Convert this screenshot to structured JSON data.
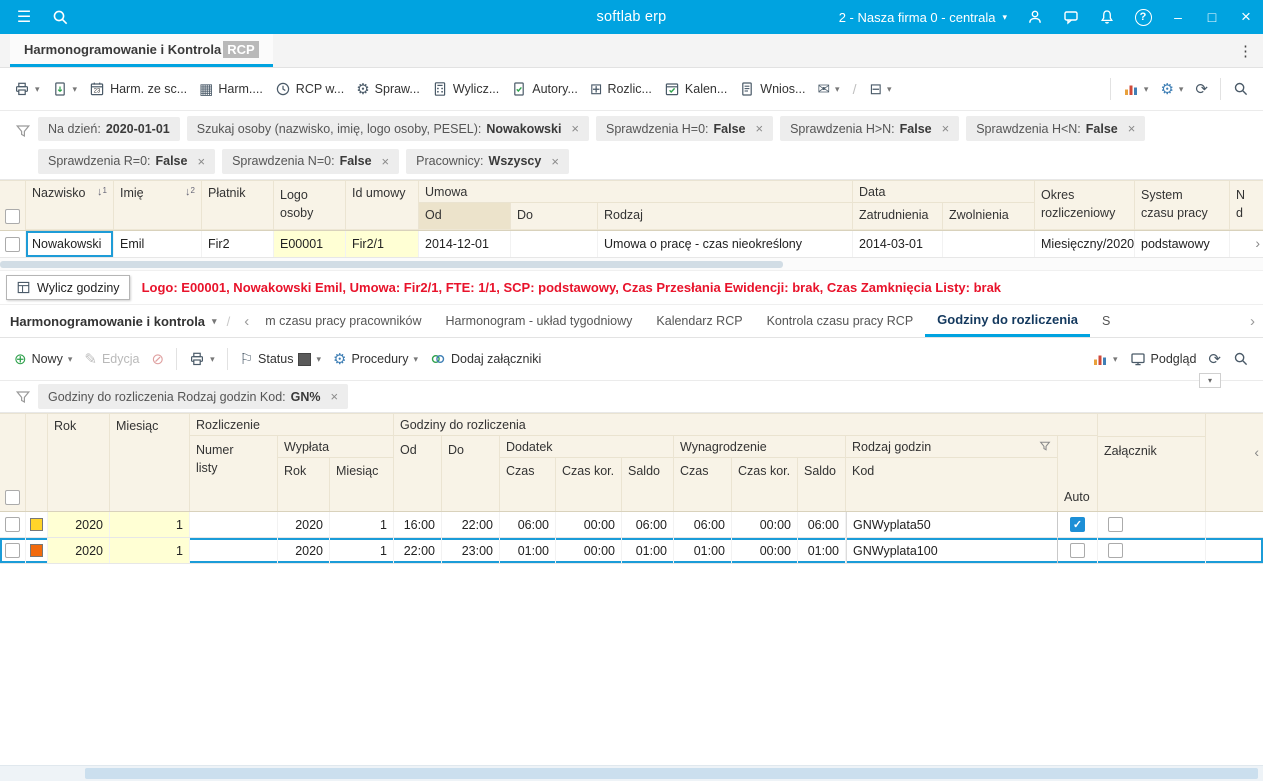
{
  "colors": {
    "topbar": "#00a3e0",
    "accent": "#00a3e0",
    "table_header_bg": "#f8f3e7",
    "selected_header_bg": "#ece3cb",
    "highlight_cell_bg": "#ffffd4",
    "status_text_red": "#e8132b",
    "active_tab_text": "#14395e",
    "checkbox_checked": "#1d8fd6"
  },
  "icons": {
    "hamburger": "☰",
    "caret_down": "▾",
    "chevron_left": "‹",
    "chevron_right": "›",
    "ellipsis_vertical": "⋮",
    "minimize": "–",
    "maximize": "□",
    "close": "×",
    "close_small": "×",
    "help": "?",
    "slash": "/",
    "refresh": "⟳",
    "envelope": "✉",
    "grid": "▦",
    "grid_plus": "⊞",
    "layout": "⊟",
    "gear": "⚙",
    "plus_circle": "⊕",
    "pencil": "✎",
    "no_entry": "⊘",
    "flag": "⚐",
    "check": "✓",
    "sort_desc": "↓"
  },
  "topbar": {
    "title": "softlab erp",
    "company": "2 - Nasza firma 0 - centrala"
  },
  "tabbar": {
    "tab_title": "Harmonogramowanie i Kontrola",
    "tab_title_highlight": "RCP"
  },
  "toolbar1": {
    "calendar_day": "23",
    "buttons": [
      "Harm. ze sc...",
      "Harm....",
      "RCP w...",
      "Spraw...",
      "Wylicz...",
      "Autory...",
      "Rozlic...",
      "Kalen...",
      "Wnios..."
    ]
  },
  "filters1": {
    "chips": [
      {
        "label": "Na dzień:",
        "value": "2020-01-01",
        "closable": false
      },
      {
        "label": "Szukaj osoby (nazwisko, imię, logo osoby, PESEL):",
        "value": "Nowakowski",
        "closable": true
      },
      {
        "label": "Sprawdzenia  H=0:",
        "value": "False",
        "closable": true
      },
      {
        "label": "Sprawdzenia  H>N:",
        "value": "False",
        "closable": true
      },
      {
        "label": "Sprawdzenia  H<N:",
        "value": "False",
        "closable": true
      },
      {
        "label": "Sprawdzenia  R=0:",
        "value": "False",
        "closable": true
      },
      {
        "label": "Sprawdzenia  N=0:",
        "value": "False",
        "closable": true
      },
      {
        "label": "Pracownicy:",
        "value": "Wszyscy",
        "closable": true
      }
    ]
  },
  "table1": {
    "headers": {
      "nazwisko": "Nazwisko",
      "sort1": "1",
      "imie": "Imię",
      "sort2": "2",
      "platnik": "Płatnik",
      "logo_l1": "Logo",
      "logo_l2": "osoby",
      "id_umowy": "Id umowy",
      "umowa": "Umowa",
      "od": "Od",
      "do": "Do",
      "rodzaj": "Rodzaj",
      "data": "Data",
      "zatrudnienia": "Zatrudnienia",
      "zwolnienia": "Zwolnienia",
      "okres_l1": "Okres",
      "okres_l2": "rozliczeniowy",
      "system_l1": "System",
      "system_l2": "czasu pracy",
      "n_l1": "N",
      "n_l2": "d"
    },
    "row": {
      "nazwisko": "Nowakowski",
      "imie": "Emil",
      "platnik": "Fir2",
      "logo": "E00001",
      "id_umowy": "Fir2/1",
      "od": "2014-12-01",
      "do": "",
      "rodzaj": "Umowa o pracę - czas nieokreślony",
      "zatrudnienia": "2014-03-01",
      "zwolnienia": "",
      "okres": "Miesięczny/2020",
      "system": "podstawowy"
    }
  },
  "statusbar": {
    "button": "Wylicz godziny",
    "info": "Logo: E00001, Nowakowski Emil, Umowa: Fir2/1, FTE: 1/1, SCP: podstawowy, Czas Przesłania Ewidencji: brak, Czas Zamknięcia Listy: brak"
  },
  "nav2": {
    "menu": "Harmonogramowanie i kontrola",
    "tabs": [
      {
        "label": "m czasu pracy pracowników",
        "active": false
      },
      {
        "label": "Harmonogram - układ tygodniowy",
        "active": false
      },
      {
        "label": "Kalendarz RCP",
        "active": false
      },
      {
        "label": "Kontrola czasu pracy RCP",
        "active": false
      },
      {
        "label": "Godziny do rozliczenia",
        "active": true
      },
      {
        "label": "S",
        "active": false
      }
    ]
  },
  "toolbar2": {
    "nowy": "Nowy",
    "edycja": "Edycja",
    "status": "Status",
    "procedury": "Procedury",
    "zalaczniki": "Dodaj załączniki",
    "podglad": "Podgląd"
  },
  "filters2": {
    "chip": {
      "label": "Godziny do rozliczenia Rodzaj godzin Kod:",
      "value": "GN%",
      "closable": true
    }
  },
  "table2": {
    "headers": {
      "rok": "Rok",
      "miesiac": "Miesiąc",
      "rozliczenie": "Rozliczenie",
      "numer_l1": "Numer",
      "numer_l2": "listy",
      "wyplata": "Wypłata",
      "w_rok": "Rok",
      "w_miesiac": "Miesiąc",
      "godziny": "Godziny do rozliczenia",
      "od": "Od",
      "do": "Do",
      "dodatek": "Dodatek",
      "czas": "Czas",
      "czas_kor": "Czas kor.",
      "saldo": "Saldo",
      "wynagrodzenie": "Wynagrodzenie",
      "czas2": "Czas",
      "czas_kor2": "Czas kor.",
      "saldo2": "Saldo",
      "rodzaj_godzin": "Rodzaj godzin",
      "kod": "Kod",
      "auto": "Auto",
      "zalacznik": "Załącznik"
    },
    "rows": [
      {
        "swatch": "#ffd42a",
        "rok": "2020",
        "miesiac": "1",
        "numer_listy": "",
        "wyplata_rok": "2020",
        "wyplata_miesiac": "1",
        "od": "16:00",
        "do": "22:00",
        "dodatek_czas": "06:00",
        "dodatek_czas_kor": "00:00",
        "dodatek_saldo": "06:00",
        "wynagrodzenie_czas": "06:00",
        "wynagrodzenie_czas_kor": "00:00",
        "wynagrodzenie_saldo": "06:00",
        "kod": "GNWyplata50",
        "auto": true,
        "zalacznik": false,
        "selected": false
      },
      {
        "swatch": "#f26a0d",
        "rok": "2020",
        "miesiac": "1",
        "numer_listy": "",
        "wyplata_rok": "2020",
        "wyplata_miesiac": "1",
        "od": "22:00",
        "do": "23:00",
        "dodatek_czas": "01:00",
        "dodatek_czas_kor": "00:00",
        "dodatek_saldo": "01:00",
        "wynagrodzenie_czas": "01:00",
        "wynagrodzenie_czas_kor": "00:00",
        "wynagrodzenie_saldo": "01:00",
        "kod": "GNWyplata100",
        "auto": false,
        "zalacznik": false,
        "selected": true
      }
    ]
  }
}
